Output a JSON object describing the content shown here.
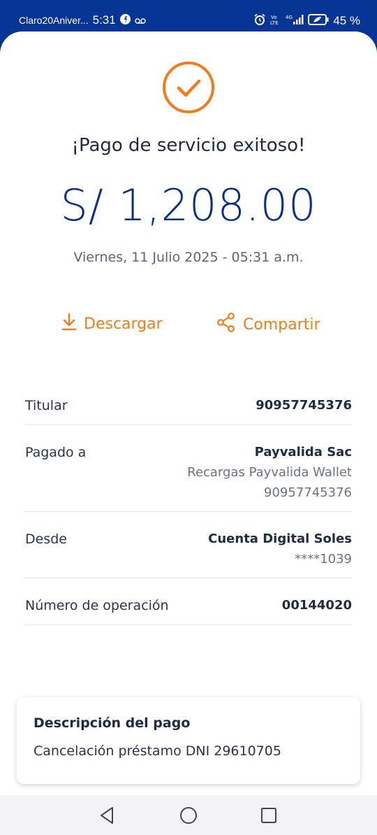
{
  "status_bar": {
    "carrier": "Claro20Aniver...",
    "time": "5:31",
    "network": "4G",
    "battery_percent": "45 %"
  },
  "receipt": {
    "title": "¡Pago de servicio exitoso!",
    "amount": "S/ 1,208.00",
    "datetime": "Viernes, 11 Julio 2025 - 05:31 a.m."
  },
  "actions": {
    "download_label": "Descargar",
    "share_label": "Compartir"
  },
  "details": {
    "titular": {
      "label": "Titular",
      "value": "90957745376"
    },
    "paid_to": {
      "label": "Pagado a",
      "name": "Payvalida Sac",
      "service": "Recargas Payvalida Wallet",
      "number": "90957745376"
    },
    "from": {
      "label": "Desde",
      "account": "Cuenta Digital Soles",
      "masked": "****1039"
    },
    "operation": {
      "label": "Número de operación",
      "value": "00144020"
    }
  },
  "description": {
    "title": "Descripción del pago",
    "text": "Cancelación préstamo DNI 29610705"
  },
  "colors": {
    "brand_blue": "#0a2f8a",
    "accent_orange": "#f07c1a"
  }
}
